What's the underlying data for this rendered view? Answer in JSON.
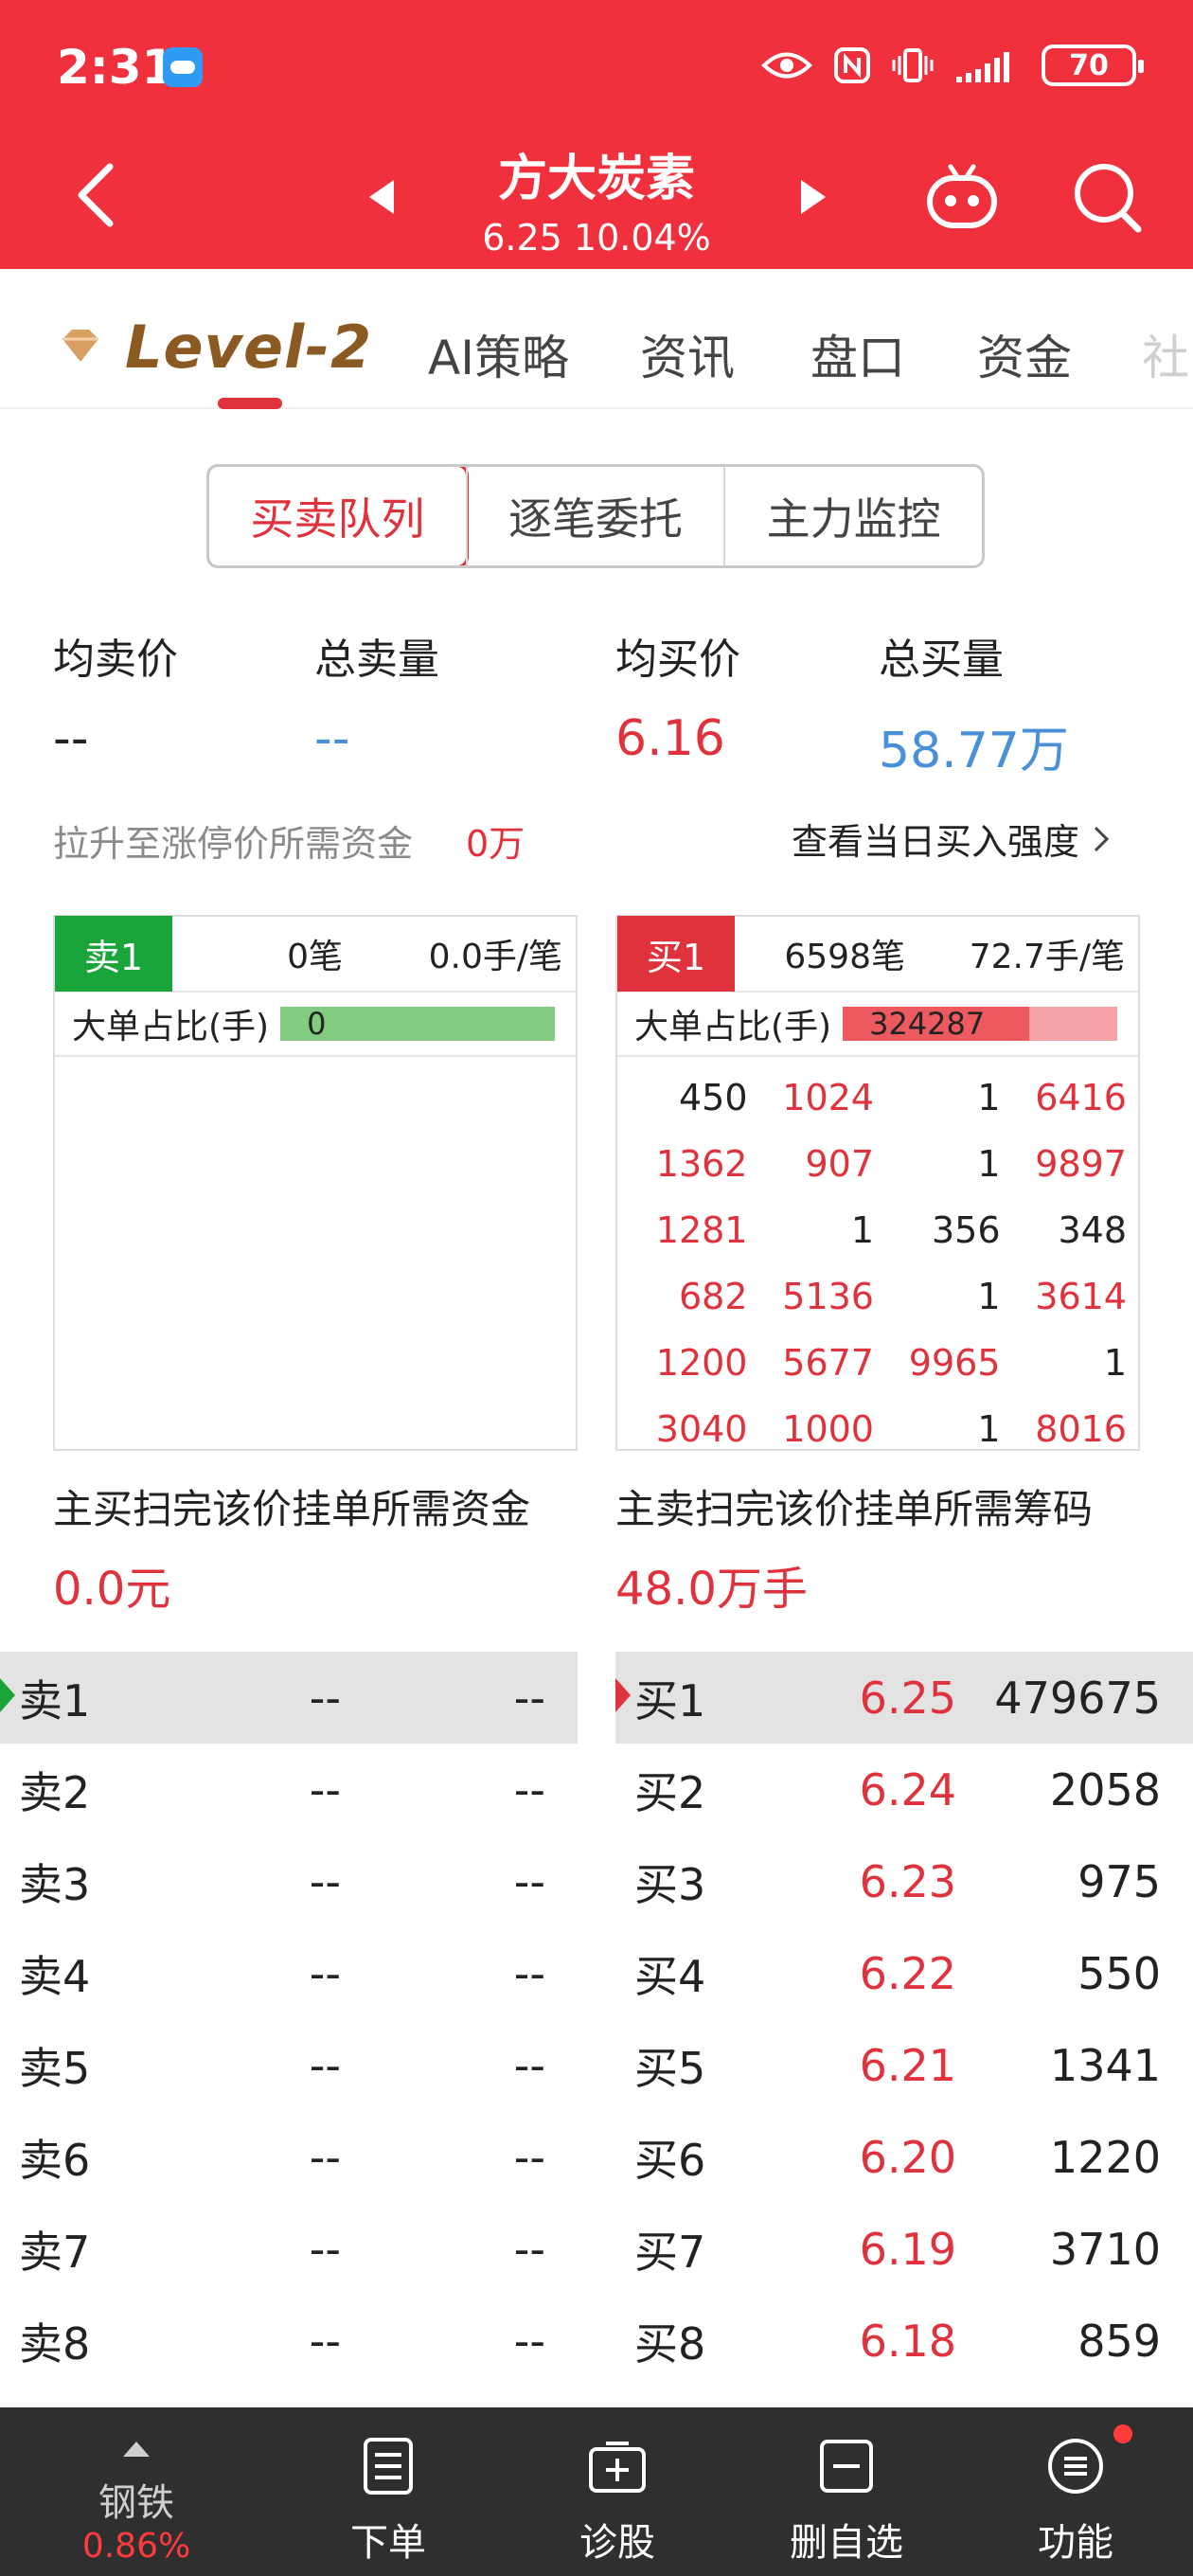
{
  "status": {
    "time": "2:31",
    "battery": "70"
  },
  "header": {
    "stock_name": "方大炭素",
    "price": "6.25",
    "change_pct": "10.04%"
  },
  "tabs": [
    "AI策略",
    "资讯",
    "盘口",
    "资金",
    "社"
  ],
  "level2_label": "Level-2",
  "segments": [
    "买卖队列",
    "逐笔委托",
    "主力监控"
  ],
  "stats": {
    "avg_sell_label": "均卖价",
    "avg_sell_value": "--",
    "total_sell_label": "总卖量",
    "total_sell_value": "--",
    "avg_buy_label": "均买价",
    "avg_buy_value": "6.16",
    "total_buy_label": "总买量",
    "total_buy_value": "58.77万"
  },
  "lift": {
    "label": "拉升至涨停价所需资金",
    "value": "0万",
    "link": "查看当日买入强度"
  },
  "sell_panel": {
    "badge": "卖1",
    "count": "0笔",
    "avg": "0.0手/笔",
    "big_label": "大单占比(手)",
    "big_value": "0",
    "big_ratio": 1.0
  },
  "buy_panel": {
    "badge": "买1",
    "count": "6598笔",
    "avg": "72.7手/笔",
    "big_label": "大单占比(手)",
    "big_value": "324287",
    "big_ratio": 0.68,
    "queue": [
      [
        "450",
        "1024",
        "1",
        "6416"
      ],
      [
        "1362",
        "907",
        "1",
        "9897"
      ],
      [
        "1281",
        "1",
        "356",
        "348"
      ],
      [
        "682",
        "5136",
        "1",
        "3614"
      ],
      [
        "1200",
        "5677",
        "9965",
        "1"
      ],
      [
        "3040",
        "1000",
        "1",
        "8016"
      ]
    ]
  },
  "need": {
    "buy_label": "主买扫完该价挂单所需资金",
    "buy_value": "0.0元",
    "sell_label": "主卖扫完该价挂单所需筹码",
    "sell_value": "48.0万手"
  },
  "sell_book": [
    {
      "label": "卖1",
      "price": "--",
      "vol": "--"
    },
    {
      "label": "卖2",
      "price": "--",
      "vol": "--"
    },
    {
      "label": "卖3",
      "price": "--",
      "vol": "--"
    },
    {
      "label": "卖4",
      "price": "--",
      "vol": "--"
    },
    {
      "label": "卖5",
      "price": "--",
      "vol": "--"
    },
    {
      "label": "卖6",
      "price": "--",
      "vol": "--"
    },
    {
      "label": "卖7",
      "price": "--",
      "vol": "--"
    },
    {
      "label": "卖8",
      "price": "--",
      "vol": "--"
    }
  ],
  "buy_book": [
    {
      "label": "买1",
      "price": "6.25",
      "vol": "479675"
    },
    {
      "label": "买2",
      "price": "6.24",
      "vol": "2058"
    },
    {
      "label": "买3",
      "price": "6.23",
      "vol": "975"
    },
    {
      "label": "买4",
      "price": "6.22",
      "vol": "550"
    },
    {
      "label": "买5",
      "price": "6.21",
      "vol": "1341"
    },
    {
      "label": "买6",
      "price": "6.20",
      "vol": "1220"
    },
    {
      "label": "买7",
      "price": "6.19",
      "vol": "3710"
    },
    {
      "label": "买8",
      "price": "6.18",
      "vol": "859"
    }
  ],
  "bottom_nav": {
    "sector_name": "钢铁",
    "sector_pct": "0.86%",
    "items": [
      "下单",
      "诊股",
      "删自选",
      "功能"
    ]
  },
  "colors": {
    "header_red": "#f0303c",
    "up_red": "#e0323c",
    "down_green": "#1aa53a",
    "accent_blue": "#4a90d9"
  }
}
